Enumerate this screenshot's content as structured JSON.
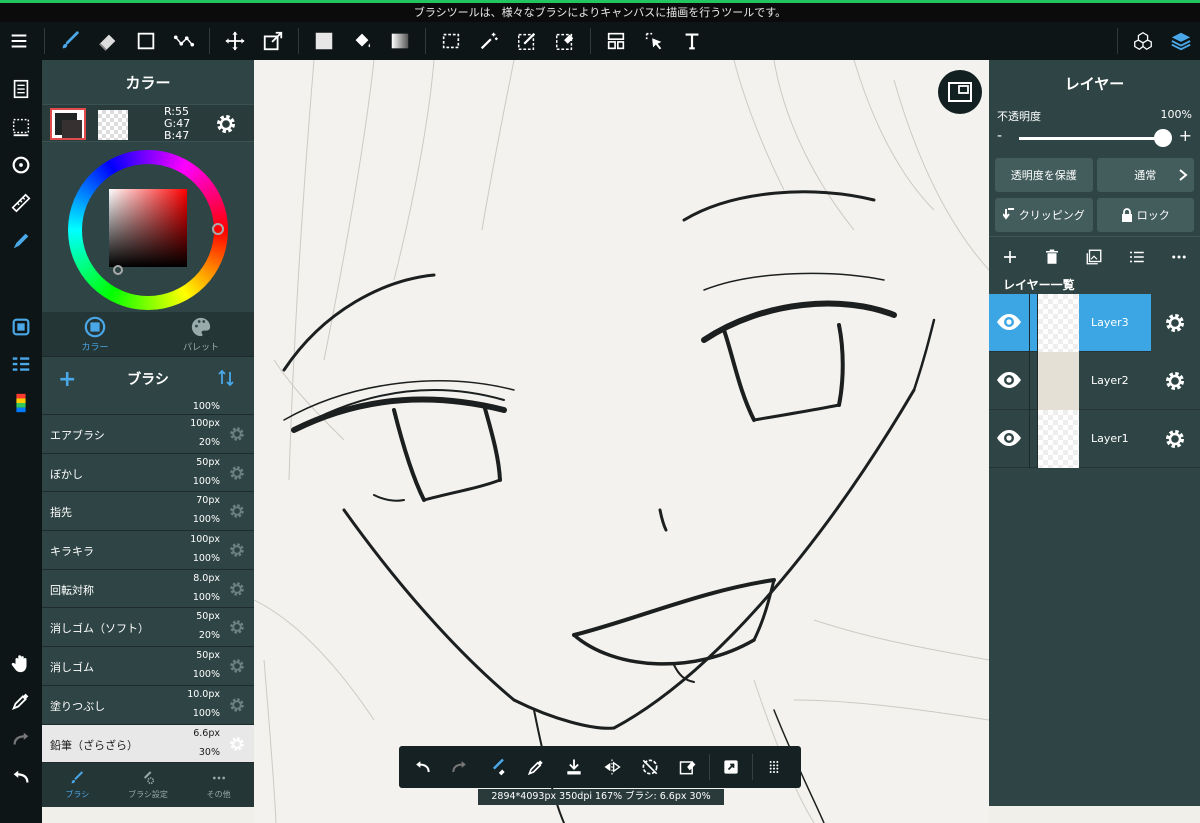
{
  "tipbar": {
    "text": "ブラシツールは、様々なブラシによりキャンバスに描画を行うツールです。"
  },
  "toolbar": {
    "left_icons": [
      "menu-icon",
      "brush-icon",
      "eraser-icon",
      "rectangle-icon",
      "dots-select-icon",
      "move-icon",
      "transform-icon",
      "fill-color-icon",
      "bucket-icon",
      "gradient-icon",
      "select-rect-icon",
      "magic-wand-icon",
      "select-pen-icon",
      "select-eraser-icon",
      "layout-icon",
      "operation-icon",
      "text-icon"
    ],
    "right_icons": [
      "3d-icon",
      "layers-icon"
    ],
    "accent": "#4aa8e8"
  },
  "color_panel": {
    "title": "カラー",
    "rgb": {
      "r": "R:55",
      "g": "G:47",
      "b": "B:47"
    },
    "main_color": "#373030",
    "tabs": [
      {
        "label": "カラー",
        "icon": "color-icon"
      },
      {
        "label": "パレット",
        "icon": "palette-icon"
      }
    ]
  },
  "brush_panel": {
    "title": "ブラシ",
    "items": [
      {
        "name": "",
        "size": "",
        "opacity": "100%"
      },
      {
        "name": "エアブラシ",
        "size": "100px",
        "opacity": "20%"
      },
      {
        "name": "ぼかし",
        "size": "50px",
        "opacity": "100%"
      },
      {
        "name": "指先",
        "size": "70px",
        "opacity": "100%"
      },
      {
        "name": "キラキラ",
        "size": "100px",
        "opacity": "100%"
      },
      {
        "name": "回転対称",
        "size": "8.0px",
        "opacity": "100%"
      },
      {
        "name": "消しゴム（ソフト）",
        "size": "50px",
        "opacity": "20%"
      },
      {
        "name": "消しゴム",
        "size": "50px",
        "opacity": "100%"
      },
      {
        "name": "塗りつぶし",
        "size": "10.0px",
        "opacity": "100%"
      },
      {
        "name": "鉛筆（ざらざら）",
        "size": "6.6px",
        "opacity": "30%"
      }
    ],
    "tabs": [
      {
        "label": "ブラシ"
      },
      {
        "label": "ブラシ設定"
      },
      {
        "label": "その他"
      }
    ]
  },
  "canvas": {
    "status": "2894*4093px 350dpi 167% ブラシ: 6.6px 30%"
  },
  "layer_panel": {
    "title": "レイヤー",
    "opacity_label": "不透明度",
    "opacity_value": "100%",
    "opacity_fraction": 1.0,
    "minus": "-",
    "plus": "+",
    "protect_label": "透明度を保護",
    "blend_label": "通常",
    "clip_label": "クリッピング",
    "lock_label": "ロック",
    "list_label": "レイヤー一覧",
    "layers": [
      {
        "name": "Layer3",
        "selected": true
      },
      {
        "name": "Layer2",
        "selected": false
      },
      {
        "name": "Layer1",
        "selected": false
      }
    ]
  }
}
